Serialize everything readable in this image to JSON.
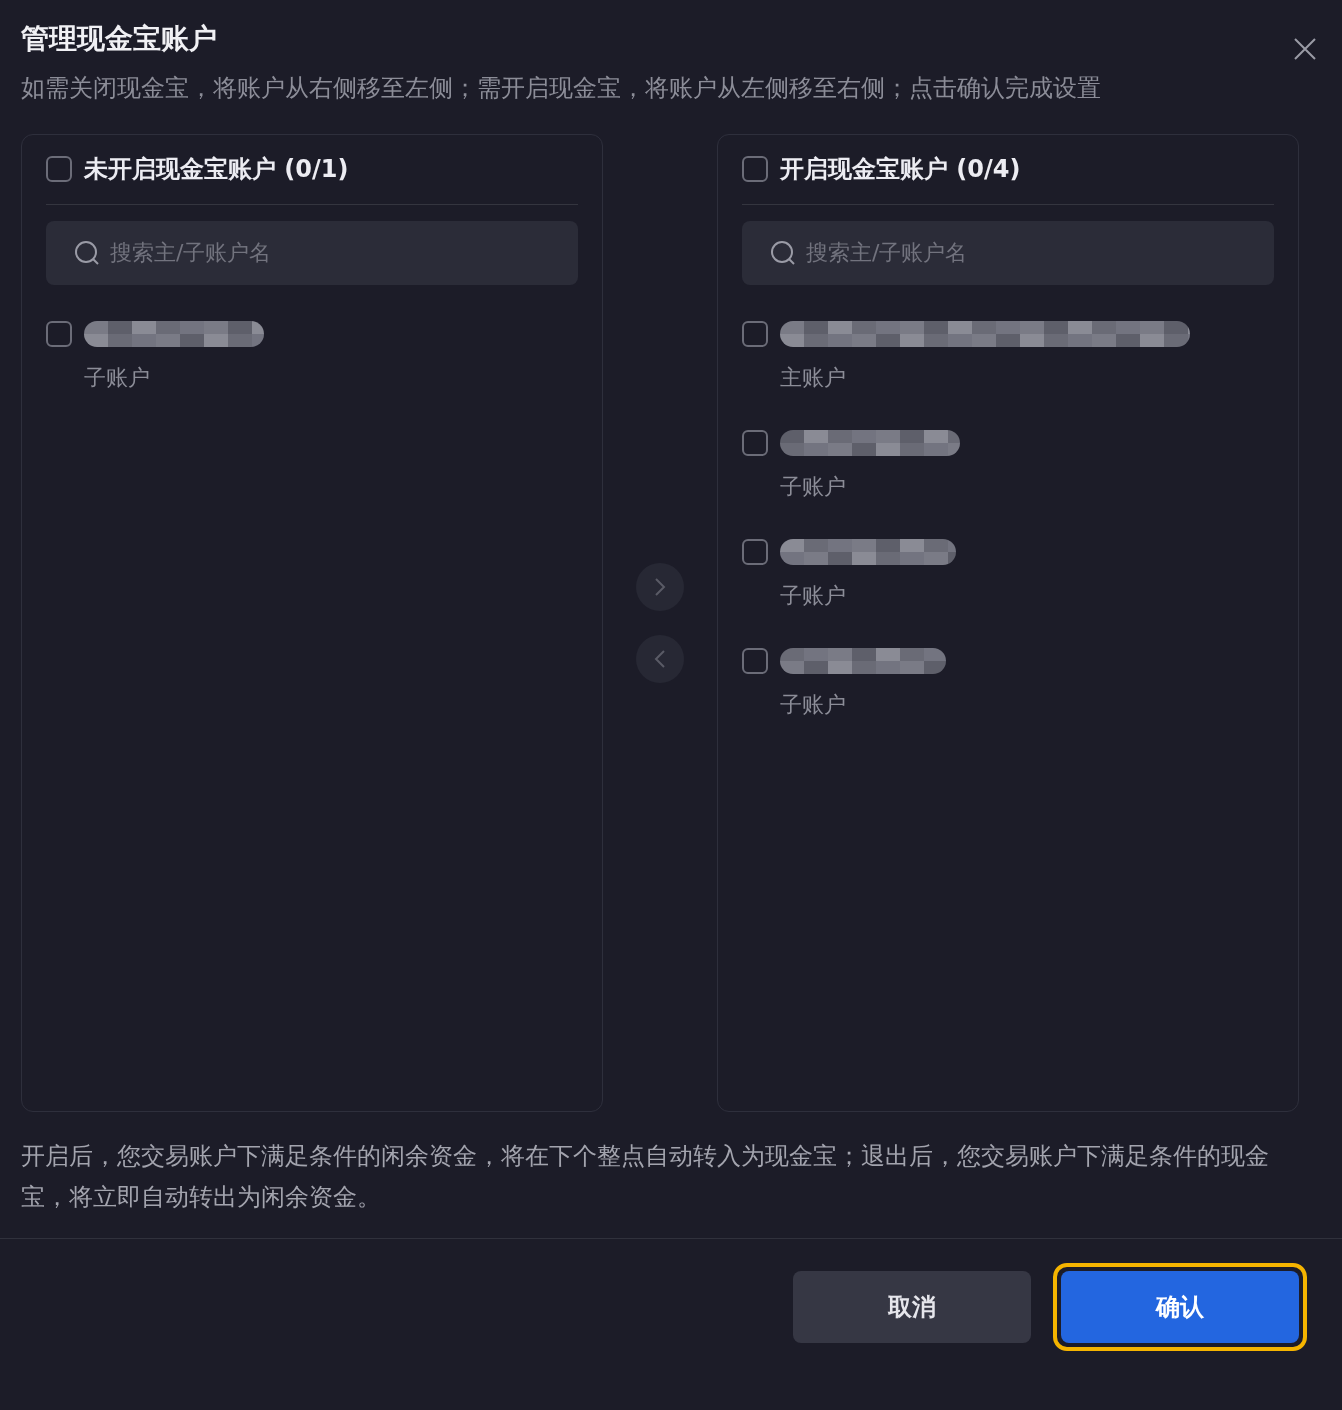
{
  "dialog": {
    "title": "管理现金宝账户",
    "instruction": "如需关闭现金宝，将账户从右侧移至左侧；需开启现金宝，将账户从左侧移至右侧；点击确认完成设置"
  },
  "panels": [
    {
      "title": "未开启现金宝账户 (0/1)",
      "checked": false,
      "search": {
        "placeholder": "搜索主/子账户名"
      },
      "items": [
        {
          "kind": "redacted",
          "checked": false,
          "type": "子账户"
        }
      ]
    },
    {
      "title": "开启现金宝账户 (0/4)",
      "checked": false,
      "search": {
        "placeholder": "搜索主/子账户名"
      },
      "items": [
        {
          "kind": "redacted",
          "checked": false,
          "type": "主账户"
        },
        {
          "kind": "redacted",
          "checked": false,
          "type": "子账户"
        },
        {
          "kind": "redacted",
          "checked": false,
          "type": "子账户"
        },
        {
          "kind": "redacted",
          "checked": false,
          "type": "子账户"
        }
      ]
    }
  ],
  "transfer": {
    "right_disabled": true,
    "left_disabled": true
  },
  "note": "开启后，您交易账户下满足条件的闲余资金，将在下个整点自动转入为现金宝；退出后，您交易账户下满足条件的现金宝，将立即自动转出为闲余资金。",
  "buttons": [
    {
      "label": "取消",
      "kind": "secondary",
      "focused": false
    },
    {
      "label": "确认",
      "kind": "primary",
      "focused": true
    }
  ]
}
